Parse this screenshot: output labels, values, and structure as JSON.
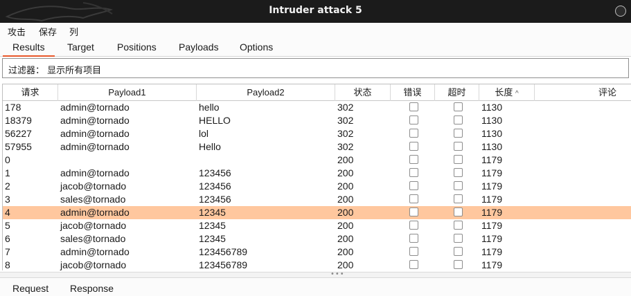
{
  "window": {
    "title": "Intruder attack 5"
  },
  "menu": [
    "攻击",
    "保存",
    "列"
  ],
  "tabs": [
    "Results",
    "Target",
    "Positions",
    "Payloads",
    "Options"
  ],
  "active_tab": "Results",
  "filter": {
    "label": "过滤器：",
    "value": "显示所有项目"
  },
  "table": {
    "columns": [
      "请求",
      "Payload1",
      "Payload2",
      "状态",
      "错误",
      "超时",
      "长度",
      "评论"
    ],
    "sorted_column": "长度",
    "sort_indicator": "^",
    "rows": [
      {
        "request": "178",
        "payload1": "admin@tornado",
        "payload2": "hello",
        "status": "302",
        "length": "1130"
      },
      {
        "request": "18379",
        "payload1": "admin@tornado",
        "payload2": "HELLO",
        "status": "302",
        "length": "1130"
      },
      {
        "request": "56227",
        "payload1": "admin@tornado",
        "payload2": "lol",
        "status": "302",
        "length": "1130"
      },
      {
        "request": "57955",
        "payload1": "admin@tornado",
        "payload2": "Hello",
        "status": "302",
        "length": "1130"
      },
      {
        "request": "0",
        "payload1": "",
        "payload2": "",
        "status": "200",
        "length": "1179"
      },
      {
        "request": "1",
        "payload1": "admin@tornado",
        "payload2": "123456",
        "status": "200",
        "length": "1179"
      },
      {
        "request": "2",
        "payload1": "jacob@tornado",
        "payload2": "123456",
        "status": "200",
        "length": "1179"
      },
      {
        "request": "3",
        "payload1": "sales@tornado",
        "payload2": "123456",
        "status": "200",
        "length": "1179"
      },
      {
        "request": "4",
        "payload1": "admin@tornado",
        "payload2": "12345",
        "status": "200",
        "length": "1179"
      },
      {
        "request": "5",
        "payload1": "jacob@tornado",
        "payload2": "12345",
        "status": "200",
        "length": "1179"
      },
      {
        "request": "6",
        "payload1": "sales@tornado",
        "payload2": "12345",
        "status": "200",
        "length": "1179"
      },
      {
        "request": "7",
        "payload1": "admin@tornado",
        "payload2": "123456789",
        "status": "200",
        "length": "1179"
      },
      {
        "request": "8",
        "payload1": "jacob@tornado",
        "payload2": "123456789",
        "status": "200",
        "length": "1179"
      }
    ],
    "selected_row_request": "4",
    "selected_row_color": "#ffc79e"
  },
  "bottom_tabs": [
    "Request",
    "Response"
  ],
  "colors": {
    "accent": "#e8572a",
    "titlebar": "#1b1b1b"
  },
  "icons": {
    "close": "close-icon",
    "sort": "sort-ascending-icon",
    "splitter": "drag-handle-icon"
  }
}
